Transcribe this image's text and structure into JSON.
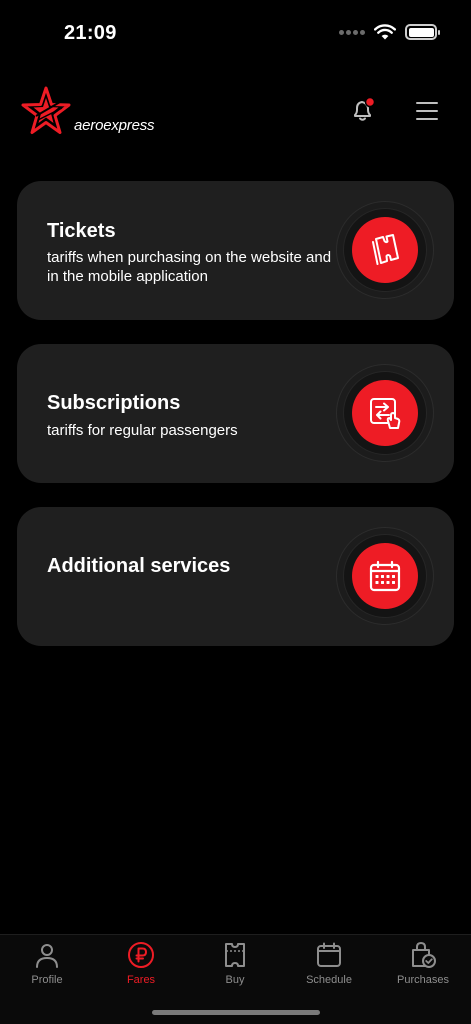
{
  "status_bar": {
    "time": "21:09"
  },
  "header": {
    "logo_text": "aeroexpress"
  },
  "cards": [
    {
      "title": "Tickets",
      "subtitle": "tariffs when purchasing on the website and in the mobile application",
      "icon": "ticket-icon"
    },
    {
      "title": "Subscriptions",
      "subtitle": "tariffs for regular passengers",
      "icon": "transfer-tap-icon"
    },
    {
      "title": "Additional services",
      "subtitle": "",
      "icon": "calendar-icon"
    }
  ],
  "nav": {
    "items": [
      {
        "label": "Profile",
        "icon": "person-icon",
        "active": false
      },
      {
        "label": "Fares",
        "icon": "ruble-icon",
        "active": true
      },
      {
        "label": "Buy",
        "icon": "ticket-icon",
        "active": false
      },
      {
        "label": "Schedule",
        "icon": "calendar-icon",
        "active": false
      },
      {
        "label": "Purchases",
        "icon": "bag-check-icon",
        "active": false
      }
    ]
  },
  "colors": {
    "accent": "#ee1c25",
    "card_bg": "#1f1f1f",
    "background": "#000000",
    "nav_inactive": "#8e8e8e"
  }
}
